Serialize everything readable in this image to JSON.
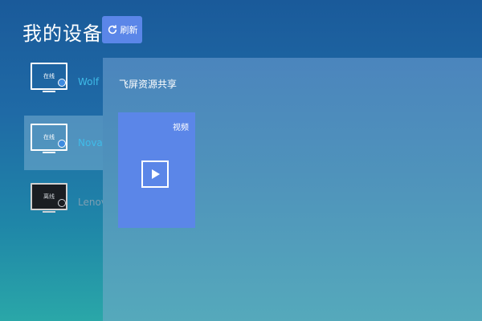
{
  "header": {
    "title": "我的设备",
    "refresh_label": "刷新"
  },
  "devices": [
    {
      "name": "Wolf",
      "status": "在线",
      "state": "online",
      "selected": false
    },
    {
      "name": "Nova",
      "status": "在线",
      "state": "online",
      "selected": true
    },
    {
      "name": "Lenov",
      "status": "离线",
      "state": "offline",
      "selected": false
    }
  ],
  "main": {
    "section_title": "飞屏资源共享",
    "cards": [
      {
        "label": "视频",
        "icon": "play-icon"
      }
    ]
  },
  "colors": {
    "accent": "#5b86e8",
    "device_name": "#3fbce9"
  }
}
